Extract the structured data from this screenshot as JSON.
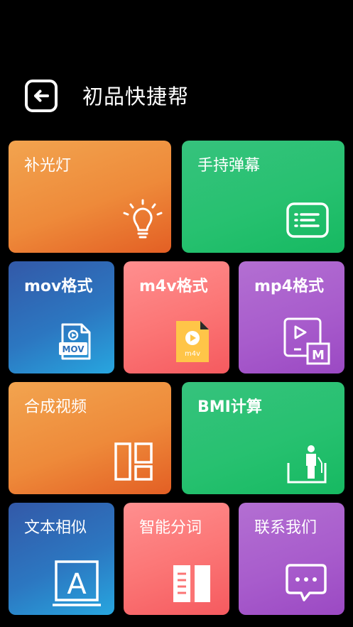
{
  "header": {
    "title": "初品快捷帮",
    "back_icon": "back-arrow-icon"
  },
  "tiles": {
    "fill_light": {
      "label": "补光灯",
      "icon": "lightbulb-icon"
    },
    "teleprompter": {
      "label": "手持弹幕",
      "icon": "teleprompter-icon"
    },
    "mov": {
      "label": "mov格式",
      "icon": "mov-file-icon",
      "badge": "MOV"
    },
    "m4v": {
      "label": "m4v格式",
      "icon": "m4v-file-icon",
      "badge": "m4v"
    },
    "mp4": {
      "label": "mp4格式",
      "icon": "mp4-convert-icon",
      "badge": "M"
    },
    "compose": {
      "label": "合成视频",
      "icon": "layout-icon"
    },
    "bmi": {
      "label": "BMI计算",
      "icon": "person-scale-icon"
    },
    "text_similar": {
      "label": "文本相似",
      "icon": "text-a-icon",
      "glyph": "A"
    },
    "segment": {
      "label": "智能分词",
      "icon": "book-list-icon"
    },
    "contact": {
      "label": "联系我们",
      "icon": "chat-bubble-icon"
    }
  },
  "colors": {
    "orange": "#ee8a3a",
    "green": "#27c170",
    "blue": "#2c77c1",
    "pink": "#fb7474",
    "purple": "#a85ccc",
    "background": "#000000"
  }
}
